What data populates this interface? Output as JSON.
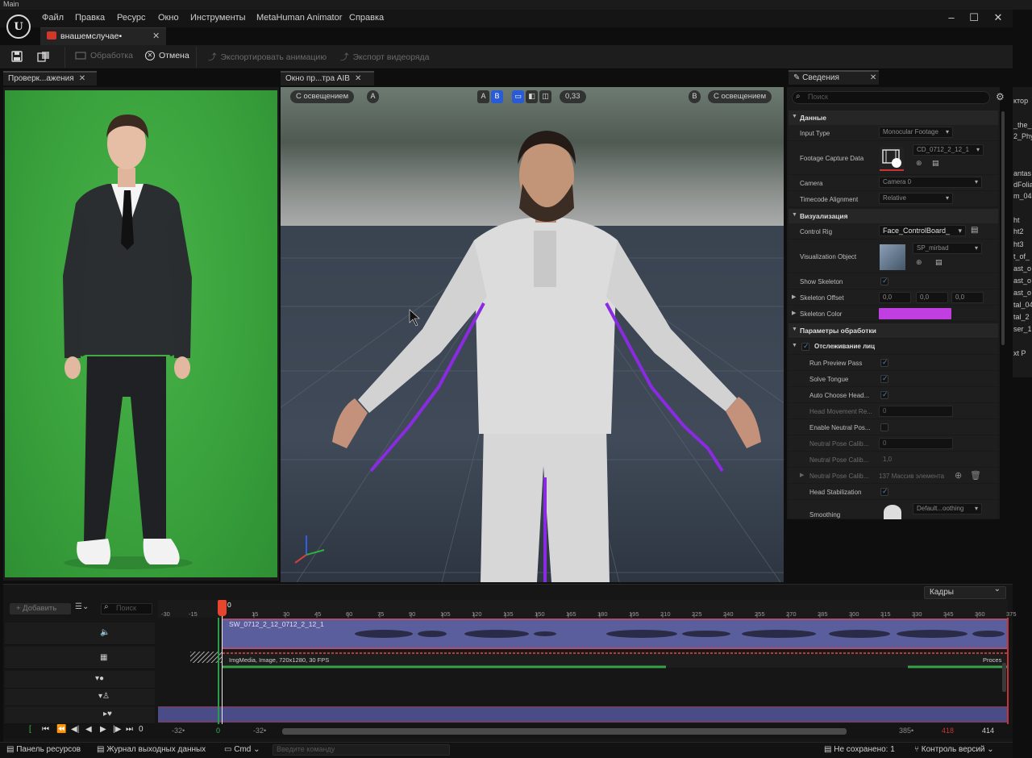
{
  "os": {
    "window_title": "Main"
  },
  "menu": {
    "items": [
      "Файл",
      "Правка",
      "Ресурс",
      "Окно",
      "Инструменты",
      "MetaHuman Animator",
      "Справка"
    ]
  },
  "window_controls": {
    "minimize": "–",
    "maximize": "☐",
    "close": "✕"
  },
  "document_tab": {
    "label": "внашемслучае•",
    "close": "✕"
  },
  "toolbar": {
    "process_label": "Обработка",
    "cancel_label": "Отмена",
    "export_anim_label": "Экспортировать анимацию",
    "export_video_label": "Экспорт видеоряда"
  },
  "left_panel": {
    "tab_label": "Проверк...ажения",
    "close": "✕"
  },
  "viewport": {
    "tab_label": "Окно пр...тра AIB",
    "close": "✕",
    "lit_left": "С освещением",
    "chip_a_left": "A",
    "chip_a": "A",
    "chip_b": "B",
    "opacity_label": "0,33",
    "chip_b_right": "B",
    "lit_right": "С освещением"
  },
  "details": {
    "tab_label": "Сведения",
    "close": "✕",
    "search_placeholder": "Поиск",
    "sections": {
      "data": "Данные",
      "visualization": "Визуализация",
      "processing": "Параметры обработки",
      "face_tracking": "Отслеживание лиц"
    },
    "rows": {
      "input_type": {
        "label": "Input Type",
        "value": "Monocular Footage"
      },
      "footage_capture": {
        "label": "Footage Capture Data",
        "value": "CD_0712_2_12_1"
      },
      "camera": {
        "label": "Camera",
        "value": "Camera 0"
      },
      "timecode": {
        "label": "Timecode Alignment",
        "value": "Relative"
      },
      "control_rig": {
        "label": "Control Rig",
        "value": "Face_ControlBoard_"
      },
      "vis_object": {
        "label": "Visualization Object",
        "value": "SP_mirbad"
      },
      "show_skeleton": {
        "label": "Show Skeleton"
      },
      "skeleton_offset": {
        "label": "Skeleton Offset",
        "x": "0,0",
        "y": "0,0",
        "z": "0,0"
      },
      "skeleton_color": {
        "label": "Skeleton Color"
      },
      "run_preview": {
        "label": "Run Preview Pass"
      },
      "solve_tongue": {
        "label": "Solve Tongue"
      },
      "auto_choose_head": {
        "label": "Auto Choose Head..."
      },
      "head_movement": {
        "label": "Head Movement Re...",
        "value": "0"
      },
      "enable_neutral": {
        "label": "Enable Neutral Pos..."
      },
      "neutral_pose_1": {
        "label": "Neutral Pose Calib...",
        "value": "0"
      },
      "neutral_pose_2": {
        "label": "Neutral Pose Calib...",
        "value": "1,0"
      },
      "neutral_pose_3": {
        "label": "Neutral Pose Calib...",
        "value": "137 Массив элемента"
      },
      "head_stabilization": {
        "label": "Head Stabilization"
      },
      "smoothing": {
        "label": "Smoothing",
        "value": "Default...oothing"
      }
    },
    "skeleton_color_hex": "#c13ee0"
  },
  "far_right": {
    "lines": [
      "ктор",
      "_the_",
      "2_Phy",
      "",
      "antas",
      "dFolia",
      "m_04",
      "",
      "ht",
      "ht2",
      "ht3",
      "t_of_",
      "ast_o",
      "ast_o",
      "ast_o",
      "tal_04",
      "tal_2",
      "ser_1",
      "",
      "xt P"
    ]
  },
  "sequencer": {
    "frames_label": "Кадры",
    "add_label": "+ Добавить",
    "search_placeholder": "Поиск",
    "ruler_left": [
      "-30",
      "-15"
    ],
    "ruler": [
      "15",
      "30",
      "45",
      "60",
      "75",
      "90",
      "105",
      "120",
      "135",
      "150",
      "165",
      "180",
      "195",
      "210",
      "225",
      "240",
      "255",
      "270",
      "285",
      "300",
      "315",
      "330",
      "345",
      "360",
      "375"
    ],
    "playhead_frame": "0",
    "audio_track_label": "SW_0712_2_12_0712_2_12_1",
    "image_track_label": "ImgMedia, Image, 720x1280, 30 FPS",
    "image_track_status": "Proces",
    "transport": {
      "frame_value": "0",
      "left_start": "-32•",
      "start": "0",
      "left_end": "-32•",
      "right_end": "385•",
      "end_red": "418",
      "end": "414"
    }
  },
  "statusbar": {
    "content_browser": "Панель ресурсов",
    "output_log": "Журнал выходных данных",
    "cmd": "Cmd",
    "cmd_placeholder": "Введите команду",
    "unsaved": "Не сохранено: 1",
    "version_control": "Контроль версий"
  },
  "colors": {
    "accent_blue": "#2a5bd6",
    "green_screen": "#3aa23c",
    "audio_track": "#5b5e9c",
    "playhead": "#e8452e"
  }
}
